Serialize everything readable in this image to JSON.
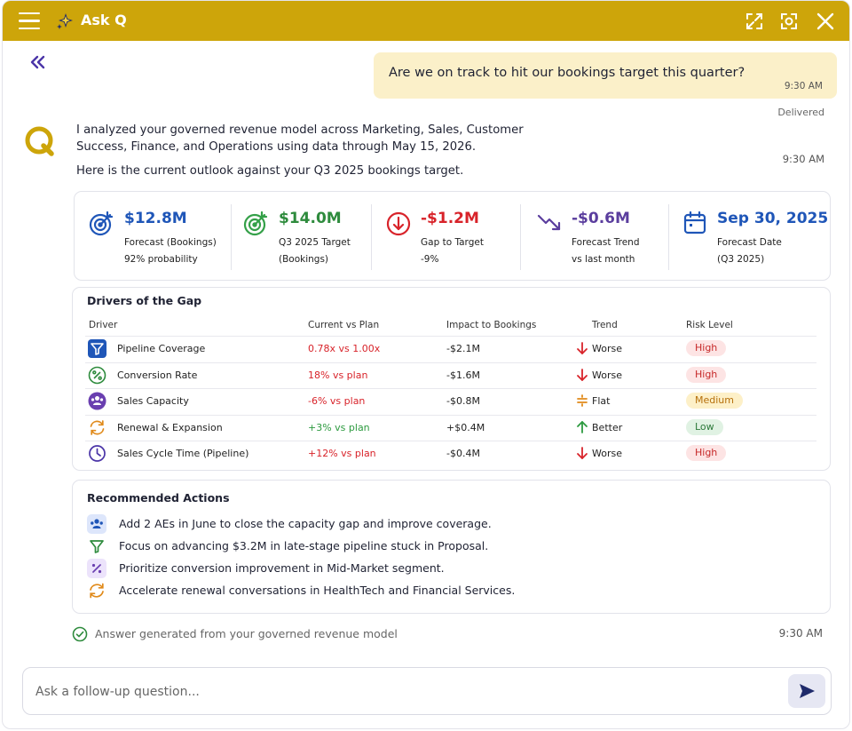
{
  "header": {
    "title": "Ask Q",
    "bg_color": "#cda50a"
  },
  "user_message": {
    "text": "Are we on track to hit our bookings target this quarter?",
    "time": "9:30 AM",
    "status": "Delivered"
  },
  "answer": {
    "intro": "I analyzed your governed revenue model across Marketing, Sales, Customer Success, Finance, and Operations using data through May 15, 2026.",
    "time": "9:30 AM",
    "outlook": "Here is the current outlook against your Q3 2025 bookings target."
  },
  "kpis": [
    {
      "icon": "target-arrow-icon",
      "value": "$12.8M",
      "line1": "Forecast (Bookings)",
      "line2": "92% probability",
      "color": "#1f56b8"
    },
    {
      "icon": "target-check-icon",
      "value": "$14.0M",
      "line1": "Q3 2025 Target",
      "line2": "(Bookings)",
      "color": "#2e8b3d"
    },
    {
      "icon": "arrow-down-circle-icon",
      "value": "-$1.2M",
      "line1": "Gap to Target",
      "line2": "-9%",
      "color": "#d8232a"
    },
    {
      "icon": "trend-down-icon",
      "value": "-$0.6M",
      "line1": "Forecast Trend",
      "line2": "vs last month",
      "color": "#5b3e9e"
    },
    {
      "icon": "calendar-icon",
      "value": "Sep 30, 2025",
      "line1": "Forecast Date",
      "line2": "(Q3 2025)",
      "color": "#1f56b8"
    }
  ],
  "drivers": {
    "title": "Drivers of the Gap",
    "columns": [
      "Driver",
      "Current vs Plan",
      "Impact to Bookings",
      "Trend",
      "Risk Level"
    ],
    "rows": [
      {
        "icon": "funnel-icon",
        "name": "Pipeline Coverage",
        "current": "0.78x vs 1.00x",
        "current_tone": "red",
        "impact": "-$2.1M",
        "trend": "Worse",
        "trend_dir": "down",
        "risk": "High"
      },
      {
        "icon": "percent-icon",
        "name": "Conversion Rate",
        "current": "18% vs plan",
        "current_tone": "red",
        "impact": "-$1.6M",
        "trend": "Worse",
        "trend_dir": "down",
        "risk": "High"
      },
      {
        "icon": "people-icon",
        "name": "Sales Capacity",
        "current": "-6% vs plan",
        "current_tone": "red",
        "impact": "-$0.8M",
        "trend": "Flat",
        "trend_dir": "flat",
        "risk": "Medium"
      },
      {
        "icon": "refresh-icon",
        "name": "Renewal & Expansion",
        "current": "+3% vs plan",
        "current_tone": "green",
        "impact": "+$0.4M",
        "trend": "Better",
        "trend_dir": "up",
        "risk": "Low"
      },
      {
        "icon": "clock-icon",
        "name": "Sales Cycle Time (Pipeline)",
        "current": "+12% vs plan",
        "current_tone": "red",
        "impact": "-$0.4M",
        "trend": "Worse",
        "trend_dir": "down",
        "risk": "High"
      }
    ]
  },
  "actions": {
    "title": "Recommended Actions",
    "items": [
      {
        "icon": "people-icon",
        "text": "Add 2 AEs in June to close the capacity gap and improve coverage."
      },
      {
        "icon": "funnel-icon",
        "text": "Focus on advancing $3.2M in late-stage pipeline stuck in Proposal."
      },
      {
        "icon": "percent-icon",
        "text": "Prioritize conversion improvement in Mid-Market segment."
      },
      {
        "icon": "refresh-icon",
        "text": "Accelerate renewal conversations in HealthTech and Financial Services."
      }
    ]
  },
  "footer_note": {
    "text": "Answer generated from your governed revenue model",
    "time": "9:30 AM"
  },
  "composer": {
    "placeholder": "Ask a follow-up question..."
  }
}
